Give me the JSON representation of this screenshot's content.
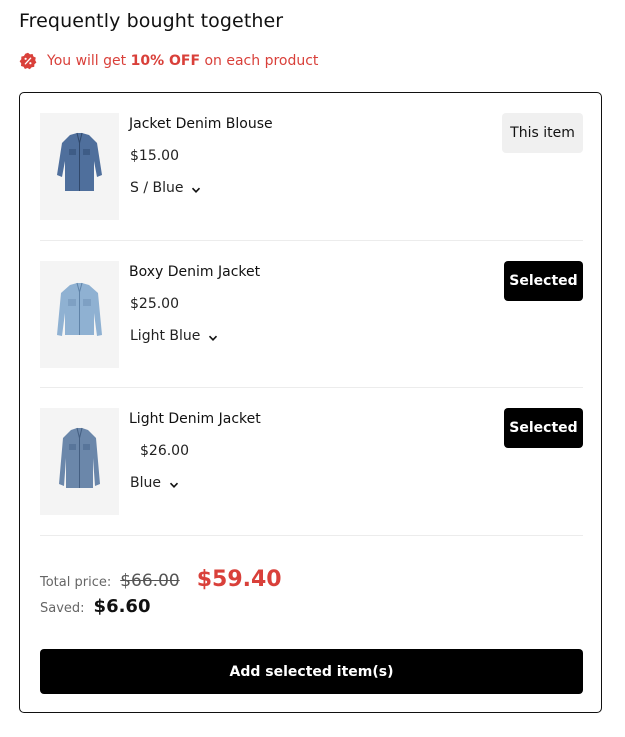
{
  "header": {
    "title": "Frequently bought together",
    "promo": {
      "prefix": "You will get",
      "highlight": "10% OFF",
      "suffix": "on each product",
      "icon": "discount-badge-icon",
      "color": "#d9403a"
    }
  },
  "products": [
    {
      "name": "Jacket Denim Blouse",
      "price": "$15.00",
      "variant": "S / Blue",
      "badge": "This item",
      "badge_style": "this",
      "thumb_color": "#4f6f9c"
    },
    {
      "name": "Boxy Denim Jacket",
      "price": "$25.00",
      "variant": "Light Blue",
      "badge": "Selected",
      "badge_style": "selected",
      "thumb_color": "#8fb1d2"
    },
    {
      "name": "Light Denim Jacket",
      "price": "$26.00",
      "variant": "Blue",
      "badge": "Selected",
      "badge_style": "selected",
      "thumb_color": "#6b87aa"
    }
  ],
  "summary": {
    "total_label": "Total price:",
    "old_price": "$66.00",
    "new_price": "$59.40",
    "saved_label": "Saved:",
    "saved_value": "$6.60"
  },
  "action": {
    "add_label": "Add selected item(s)"
  }
}
